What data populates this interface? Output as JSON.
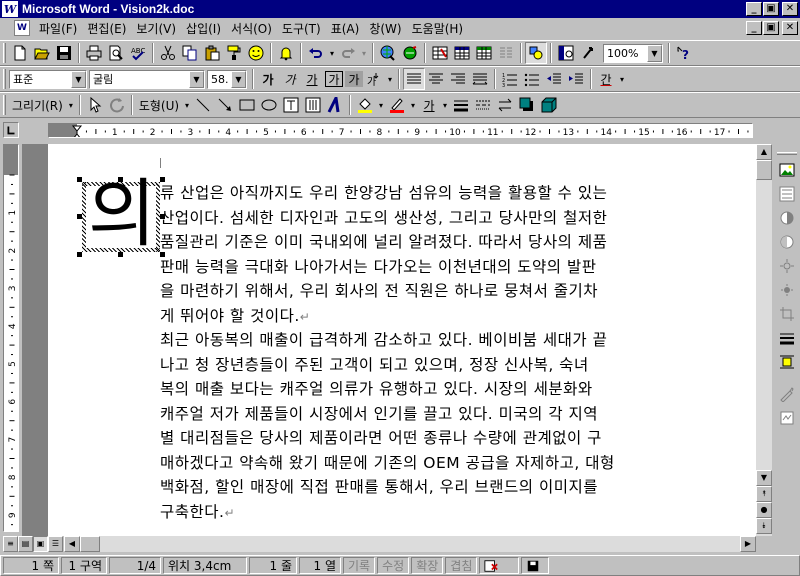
{
  "window": {
    "title": "Microsoft Word - Vision2k.doc",
    "app_icon_letter": "W",
    "controls": [
      "_",
      "▣",
      "✕"
    ]
  },
  "menu": {
    "items": [
      "파일(F)",
      "편집(E)",
      "보기(V)",
      "삽입(I)",
      "서식(O)",
      "도구(T)",
      "표(A)",
      "창(W)",
      "도움말(H)"
    ]
  },
  "standard_toolbar": {
    "zoom": "100%",
    "buttons": [
      "new-icon",
      "open-icon",
      "save-icon",
      "print-icon",
      "print-preview-icon",
      "spelling-icon",
      "cut-icon",
      "copy-icon",
      "paste-icon",
      "format-painter-icon",
      "smiley-icon",
      "bell-icon",
      "undo-icon",
      "redo-icon",
      "hyperlink-icon",
      "web-toolbar-icon",
      "tables-borders-icon",
      "insert-table-icon",
      "insert-excel-icon",
      "columns-icon",
      "drawing-icon",
      "document-map-icon",
      "show-hide-icon",
      "help-icon"
    ]
  },
  "formatting_toolbar": {
    "style": "표준",
    "font": "굴림",
    "size": "58.",
    "buttons": [
      "가",
      "가",
      "가",
      "가",
      "가"
    ],
    "color_label": "간"
  },
  "drawing_toolbar": {
    "draw_menu": "그리기(R)",
    "autoshapes_menu": "도형(U)",
    "text_color_label": "가"
  },
  "ruler": {
    "h_numbers": [
      "1",
      "2",
      "3",
      "4",
      "5",
      "6",
      "7",
      "8",
      "9",
      "10",
      "11",
      "12",
      "13",
      "14",
      "15",
      "16",
      "17"
    ],
    "v_numbers": [
      "1",
      "2",
      "3",
      "4",
      "5",
      "6",
      "7",
      "8",
      "9"
    ]
  },
  "document": {
    "drop_cap": "의",
    "lines": [
      "류 산업은 아직까지도 우리 한양강남 섬유의 능력을 활용할 수 있는",
      "산업이다. 섬세한 디자인과 고도의 생산성, 그리고 당사만의 철저한",
      "품질관리 기준은 이미 국내외에 널리 알려졌다. 따라서 당사의 제품",
      "판매 능력을 극대화  나아가서는 다가오는 이천년대의 도약의 발판",
      "을 마련하기 위해서, 우리 회사의 전 직원은 하나로 뭉쳐서 줄기차",
      "게 뛰어야 할 것이다.",
      "최근 아동복의 매출이 급격하게 감소하고 있다. 베이비붐 세대가 끝",
      "나고 청 장년층들이 주된 고객이 되고 있으며,  정장 신사복, 숙녀",
      "복의 매출 보다는 캐주얼 의류가 유행하고 있다. 시장의 세분화와",
      "캐주얼 저가 제품들이 시장에서 인기를 끌고 있다. 미국의 각 지역",
      "별 대리점들은 당사의 제품이라면 어떤 종류나 수량에 관계없이 구",
      "매하겠다고 약속해 왔기 때문에 기존의 OEM 공급을 자제하고, 대형",
      "백화점, 할인 매장에 직접 판매를 통해서, 우리 브랜드의 이미지를",
      "구축한다."
    ],
    "paragraph_mark": "↵"
  },
  "status": {
    "page": "1 쪽",
    "section": "1 구역",
    "pages": "1/4",
    "position": "위치 3,4cm",
    "line": "1 줄",
    "column": "1 열",
    "rec": "기록",
    "trk": "수정",
    "ext": "확장",
    "ovr": "겹침"
  }
}
